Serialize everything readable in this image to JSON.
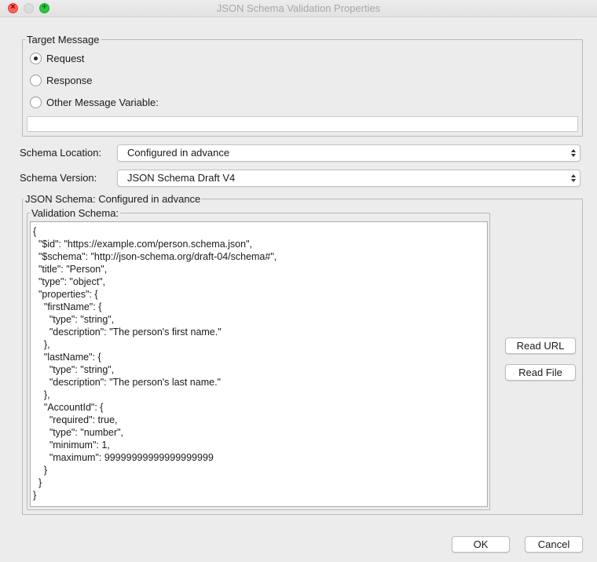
{
  "window": {
    "title": "JSON Schema Validation Properties"
  },
  "target_message": {
    "legend": "Target Message",
    "options": [
      {
        "label": "Request",
        "selected": true
      },
      {
        "label": "Response",
        "selected": false
      },
      {
        "label": "Other Message Variable:",
        "selected": false
      }
    ],
    "variable_value": ""
  },
  "schema_location": {
    "label": "Schema Location:",
    "value": "Configured in advance"
  },
  "schema_version": {
    "label": "Schema Version:",
    "value": "JSON Schema Draft V4"
  },
  "json_schema": {
    "legend": "JSON Schema: Configured in advance",
    "validation_legend": "Validation Schema:",
    "content": "{\n  \"$id\": \"https://example.com/person.schema.json\",\n  \"$schema\": \"http://json-schema.org/draft-04/schema#\",\n  \"title\": \"Person\",\n  \"type\": \"object\",\n  \"properties\": {\n    \"firstName\": {\n      \"type\": \"string\",\n      \"description\": \"The person's first name.\"\n    },\n    \"lastName\": {\n      \"type\": \"string\",\n      \"description\": \"The person's last name.\"\n    },\n    \"AccountId\": {\n      \"required\": true,\n      \"type\": \"number\",\n      \"minimum\": 1,\n      \"maximum\": 99999999999999999999\n    }\n  }\n}",
    "read_url_label": "Read URL",
    "read_file_label": "Read File"
  },
  "footer": {
    "ok_label": "OK",
    "cancel_label": "Cancel"
  },
  "icons": {
    "close": "close-icon",
    "minimize": "minimize-icon",
    "zoom": "zoom-icon"
  },
  "colors": {
    "close": "#ff5f57",
    "minimize": "#dcdcdc",
    "zoom": "#28c840",
    "background": "#ececec"
  }
}
